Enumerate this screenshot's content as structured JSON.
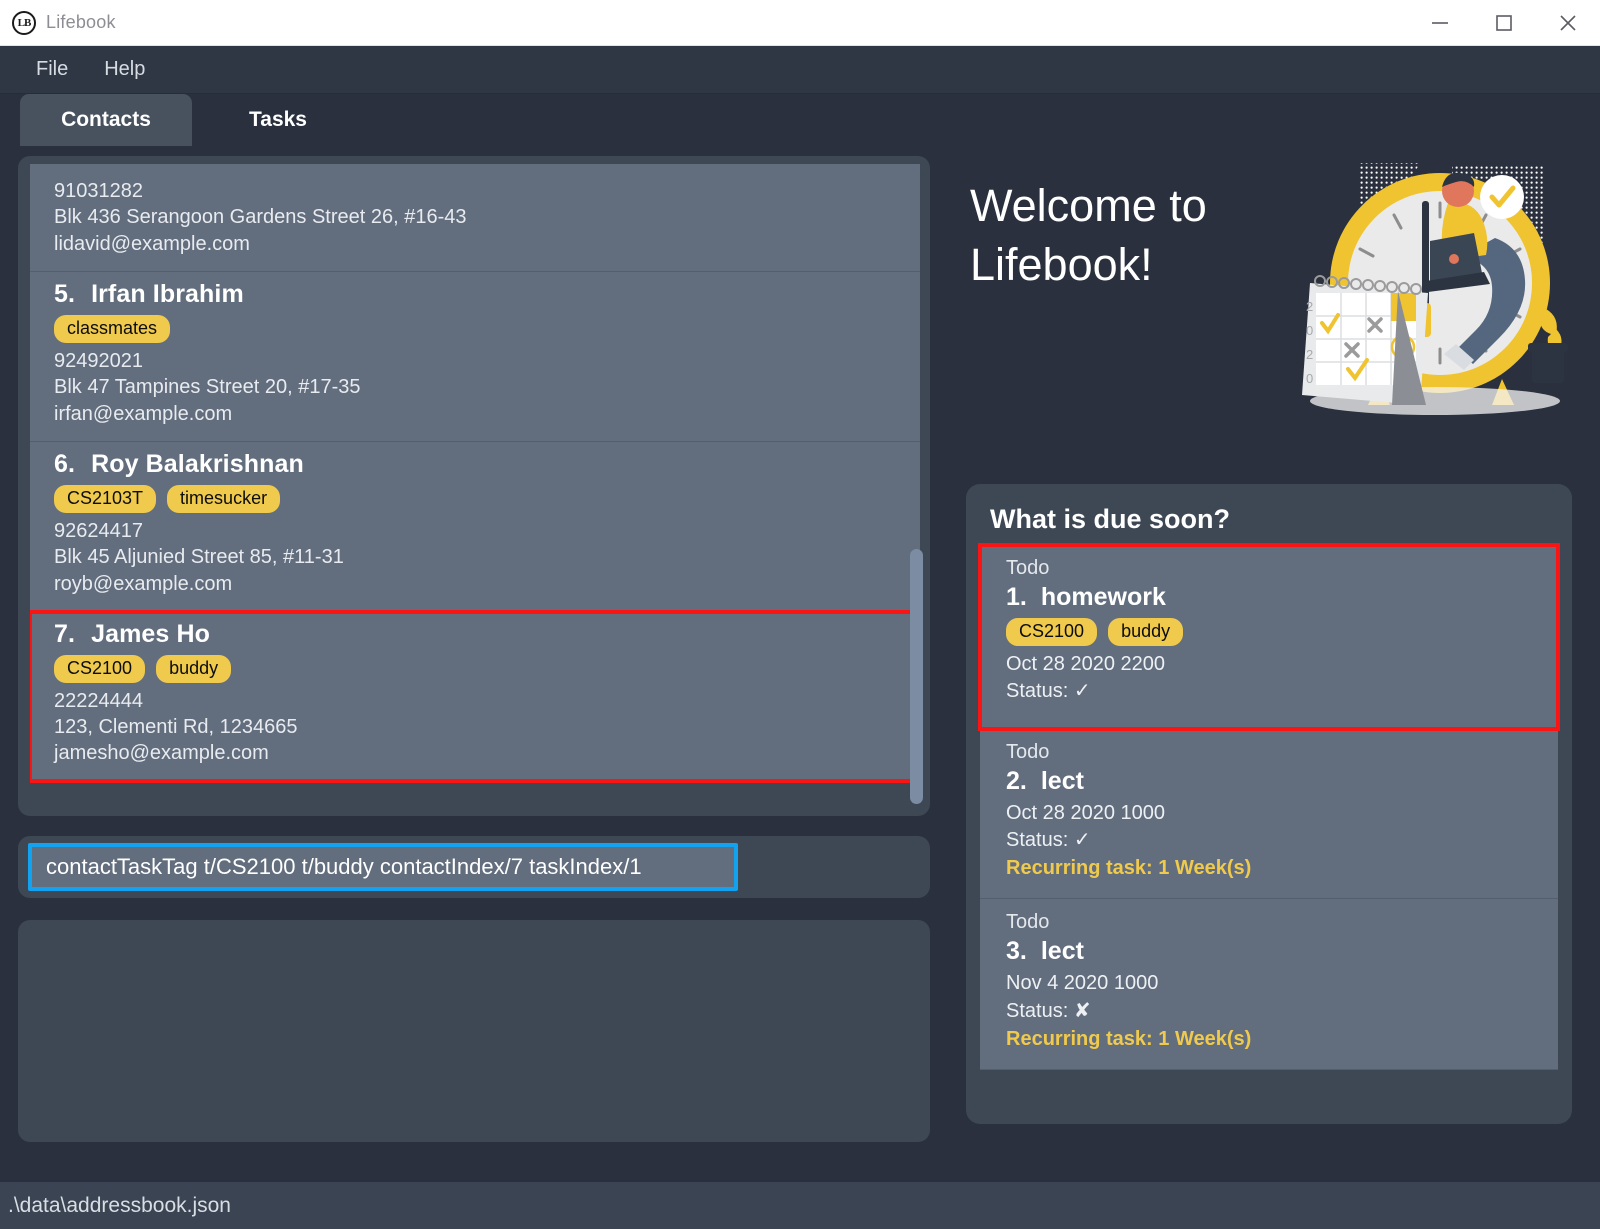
{
  "window": {
    "title": "Lifebook",
    "icon": "LB",
    "icon_name": "lifebook-logo-icon",
    "minimize_label": "Minimize",
    "maximize_label": "Maximize",
    "close_label": "Close"
  },
  "menubar": {
    "items": [
      "File",
      "Help"
    ]
  },
  "tabs": [
    {
      "label": "Contacts",
      "active": true
    },
    {
      "label": "Tasks",
      "active": false
    }
  ],
  "contacts": [
    {
      "index": "",
      "name": "",
      "partial": true,
      "tags": [],
      "phone": "91031282",
      "address": "Blk 436 Serangoon Gardens Street 26, #16-43",
      "email": "lidavid@example.com",
      "selected": false
    },
    {
      "index": "5.",
      "name": "Irfan Ibrahim",
      "partial": false,
      "tags": [
        "classmates"
      ],
      "phone": "92492021",
      "address": "Blk 47 Tampines Street 20, #17-35",
      "email": "irfan@example.com",
      "selected": false
    },
    {
      "index": "6.",
      "name": "Roy Balakrishnan",
      "partial": false,
      "tags": [
        "CS2103T",
        "timesucker"
      ],
      "phone": "92624417",
      "address": "Blk 45 Aljunied Street 85, #11-31",
      "email": "royb@example.com",
      "selected": false
    },
    {
      "index": "7.",
      "name": "James Ho",
      "partial": false,
      "tags": [
        "CS2100",
        "buddy"
      ],
      "phone": "22224444",
      "address": "123, Clementi Rd, 1234665",
      "email": "jamesho@example.com",
      "selected": true
    }
  ],
  "command": {
    "value": "contactTaskTag t/CS2100 t/buddy contactIndex/7 taskIndex/1",
    "placeholder": "Enter command here..."
  },
  "result": {
    "text": ""
  },
  "welcome": {
    "heading": "Welcome to\nLifebook!"
  },
  "due_soon": {
    "title": "What is due soon?",
    "tasks": [
      {
        "type": "Todo",
        "index": "1.",
        "name": "homework",
        "tags": [
          "CS2100",
          "buddy"
        ],
        "datetime": "Oct 28 2020 2200",
        "status_label": "Status:",
        "status_icon": "✓",
        "recurring": "",
        "selected": true
      },
      {
        "type": "Todo",
        "index": "2.",
        "name": "lect",
        "tags": [],
        "datetime": "Oct 28 2020 1000",
        "status_label": "Status:",
        "status_icon": "✓",
        "recurring": "Recurring task: 1 Week(s)",
        "selected": false
      },
      {
        "type": "Todo",
        "index": "3.",
        "name": "lect",
        "tags": [],
        "datetime": "Nov 4 2020 1000",
        "status_label": "Status:",
        "status_icon": "✘",
        "recurring": "Recurring task: 1 Week(s)",
        "selected": false
      }
    ]
  },
  "statusbar": {
    "path": ".\\data\\addressbook.json"
  },
  "colors": {
    "app_background": "#2a303d",
    "panel": "#3e4855",
    "card": "#626d7d",
    "tag_yellow": "#f0ca4d",
    "accent_blue": "#12a2f0",
    "highlight_red": "#fa1414",
    "text_primary": "#ffffff",
    "recurring_yellow": "#f0ca4d"
  }
}
